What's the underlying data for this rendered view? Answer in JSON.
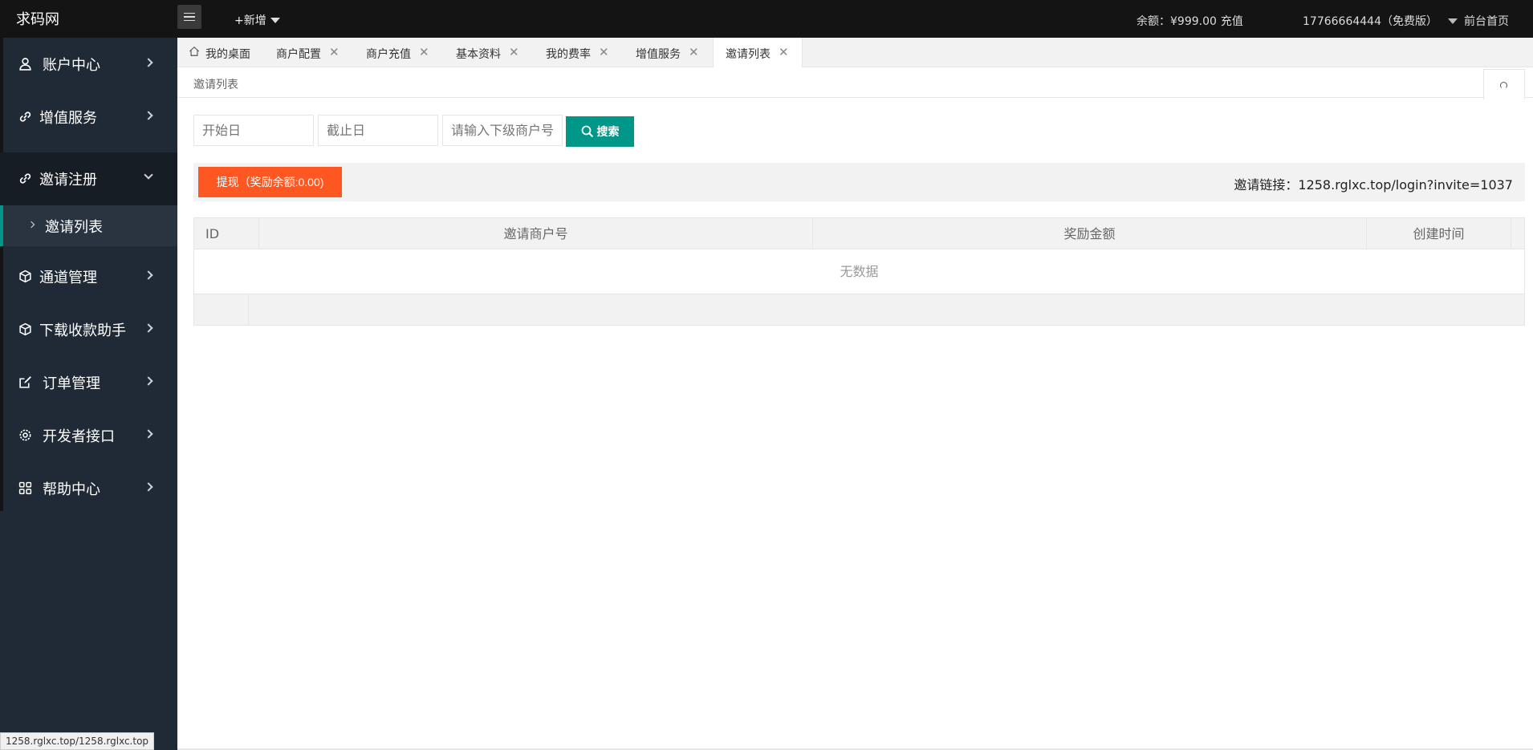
{
  "header": {
    "logo": "求码网",
    "new_label": "+新增",
    "balance": "余额：¥999.00",
    "recharge": "充值",
    "user": "17766664444（免费版）",
    "front_home": "前台首页"
  },
  "sidebar": {
    "items": [
      {
        "label": "账户中心",
        "icon": "user-icon"
      },
      {
        "label": "增值服务",
        "icon": "link-icon"
      },
      {
        "label": "邀请注册",
        "icon": "link-icon"
      },
      {
        "label": "通道管理",
        "icon": "cube-icon"
      },
      {
        "label": "下载收款助手",
        "icon": "cube-icon"
      },
      {
        "label": "订单管理",
        "icon": "edit-icon"
      },
      {
        "label": "开发者接口",
        "icon": "gear-icon"
      },
      {
        "label": "帮助中心",
        "icon": "grid-icon"
      }
    ],
    "sub_item": "邀请列表"
  },
  "tabs": [
    {
      "label": "我的桌面"
    },
    {
      "label": "商户配置"
    },
    {
      "label": "商户充值"
    },
    {
      "label": "基本资料"
    },
    {
      "label": "我的费率"
    },
    {
      "label": "增值服务"
    },
    {
      "label": "邀请列表"
    }
  ],
  "breadcrumb": "邀请列表",
  "search": {
    "start_placeholder": "开始日",
    "end_placeholder": "截止日",
    "merchant_placeholder": "请输入下级商户号",
    "button": "搜索"
  },
  "toolbar": {
    "withdraw": "提现（奖励余额:0.00)",
    "invite_link": "邀请链接：1258.rglxc.top/login?invite=1037"
  },
  "table": {
    "columns": [
      "ID",
      "邀请商户号",
      "奖励金额",
      "创建时间"
    ],
    "empty_text": "无数据"
  },
  "status_bar": "1258.rglxc.top/1258.rglxc.top",
  "colors": {
    "accent": "#009688",
    "warning": "#ff5722",
    "header_bg": "#141414",
    "sidebar_bg": "#1f2a36"
  }
}
